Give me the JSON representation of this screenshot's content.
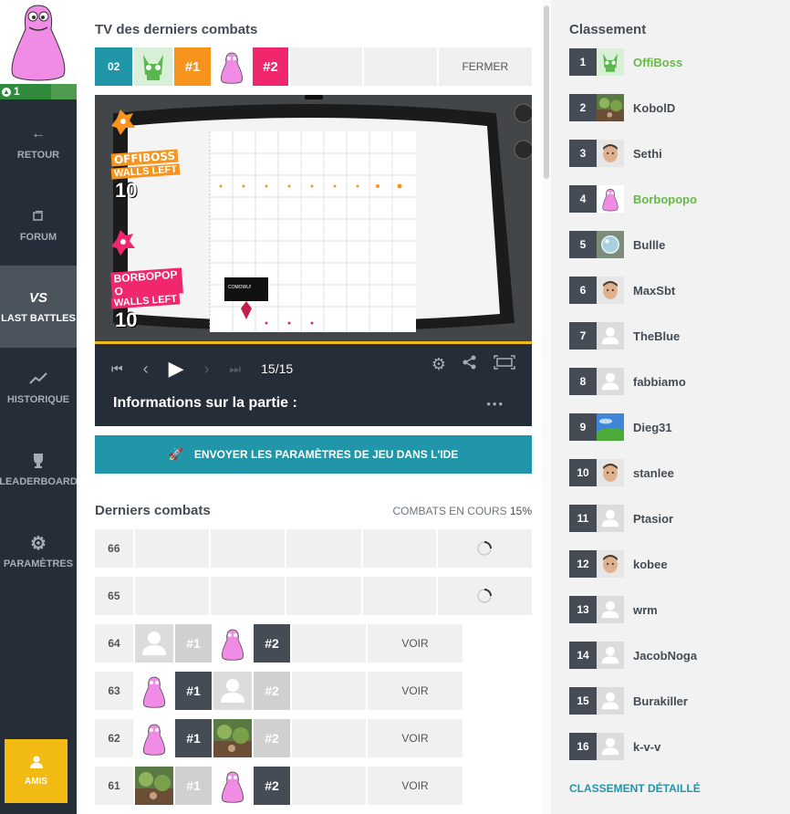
{
  "user": {
    "level": "1",
    "level_progress": 0.67
  },
  "nav": {
    "back": "RETOUR",
    "forum": "FORUM",
    "last_battles": "LAST BATTLES",
    "history": "HISTORIQUE",
    "leaderboard": "LEADERBOARD",
    "settings": "PARAMÈTRES",
    "friends": "AMIS"
  },
  "tv": {
    "title": "TV des derniers combats",
    "battle_id": "02",
    "rank1": "#1",
    "rank2": "#2",
    "close": "FERMER",
    "frame": "15/15",
    "info": "Informations sur la partie :",
    "more": "•••",
    "p1_name": "OFFIBOSS",
    "p2_name": "BORBOPOPO",
    "walls_left": "WALLS LEFT",
    "p1_walls": "10",
    "p2_walls": "10",
    "speech": "COMOWU!"
  },
  "ide_button": "ENVOYER LES PARAMÈTRES DE JEU DANS L'IDE",
  "battles": {
    "title": "Derniers combats",
    "progress_label": "COMBATS EN COURS",
    "progress_value": "15%",
    "rows": [
      {
        "id": "66",
        "status": "loading",
        "p1": "",
        "p1_rank": "",
        "p2": "",
        "p2_rank": "",
        "action": ""
      },
      {
        "id": "65",
        "status": "loading",
        "p1": "",
        "p1_rank": "",
        "p2": "",
        "p2_rank": "",
        "action": ""
      },
      {
        "id": "64",
        "status": "done",
        "p1": "ghost",
        "p1_rank": "#1",
        "p2": "barbapapa",
        "p2_rank": "#2",
        "action": "VOIR",
        "winner": 2
      },
      {
        "id": "63",
        "status": "done",
        "p1": "barbapapa",
        "p1_rank": "#1",
        "p2": "ghost",
        "p2_rank": "#2",
        "action": "VOIR",
        "winner": 1
      },
      {
        "id": "62",
        "status": "done",
        "p1": "barbapapa",
        "p1_rank": "#1",
        "p2": "photo",
        "p2_rank": "#2",
        "action": "VOIR",
        "winner": 1
      },
      {
        "id": "61",
        "status": "done",
        "p1": "photo",
        "p1_rank": "#1",
        "p2": "barbapapa",
        "p2_rank": "#2",
        "action": "VOIR",
        "winner": 2
      }
    ]
  },
  "leaderboard": {
    "title": "Classement",
    "link": "CLASSEMENT DÉTAILLÉ",
    "rows": [
      {
        "rank": "1",
        "name": "OffiBoss",
        "avatar": "skull",
        "highlight": true
      },
      {
        "rank": "2",
        "name": "KobolD",
        "avatar": "plant",
        "highlight": false
      },
      {
        "rank": "3",
        "name": "Sethi",
        "avatar": "face",
        "highlight": false
      },
      {
        "rank": "4",
        "name": "Borbopopo",
        "avatar": "barbapapa",
        "highlight": true
      },
      {
        "rank": "5",
        "name": "Bullle",
        "avatar": "bubble",
        "highlight": false
      },
      {
        "rank": "6",
        "name": "MaxSbt",
        "avatar": "face",
        "highlight": false
      },
      {
        "rank": "7",
        "name": "TheBlue",
        "avatar": "ghost",
        "highlight": false
      },
      {
        "rank": "8",
        "name": "fabbiamo",
        "avatar": "ghost",
        "highlight": false
      },
      {
        "rank": "9",
        "name": "Dieg31",
        "avatar": "landscape",
        "highlight": false
      },
      {
        "rank": "10",
        "name": "stanlee",
        "avatar": "face",
        "highlight": false
      },
      {
        "rank": "11",
        "name": "Ptasior",
        "avatar": "ghost",
        "highlight": false
      },
      {
        "rank": "12",
        "name": "kobee",
        "avatar": "face",
        "highlight": false
      },
      {
        "rank": "13",
        "name": "wrm",
        "avatar": "ghost",
        "highlight": false
      },
      {
        "rank": "14",
        "name": "JacobNoga",
        "avatar": "ghost",
        "highlight": false
      },
      {
        "rank": "15",
        "name": "Burakiller",
        "avatar": "ghost",
        "highlight": false
      },
      {
        "rank": "16",
        "name": "k-v-v",
        "avatar": "ghost",
        "highlight": false
      }
    ]
  },
  "colors": {
    "sidebar": "#252e38",
    "accent_teal": "#2096a8",
    "rank1_orange": "#f7941d",
    "rank2_pink": "#f0276c",
    "amis_yellow": "#f2bb13",
    "highlight_green": "#68b84b"
  }
}
